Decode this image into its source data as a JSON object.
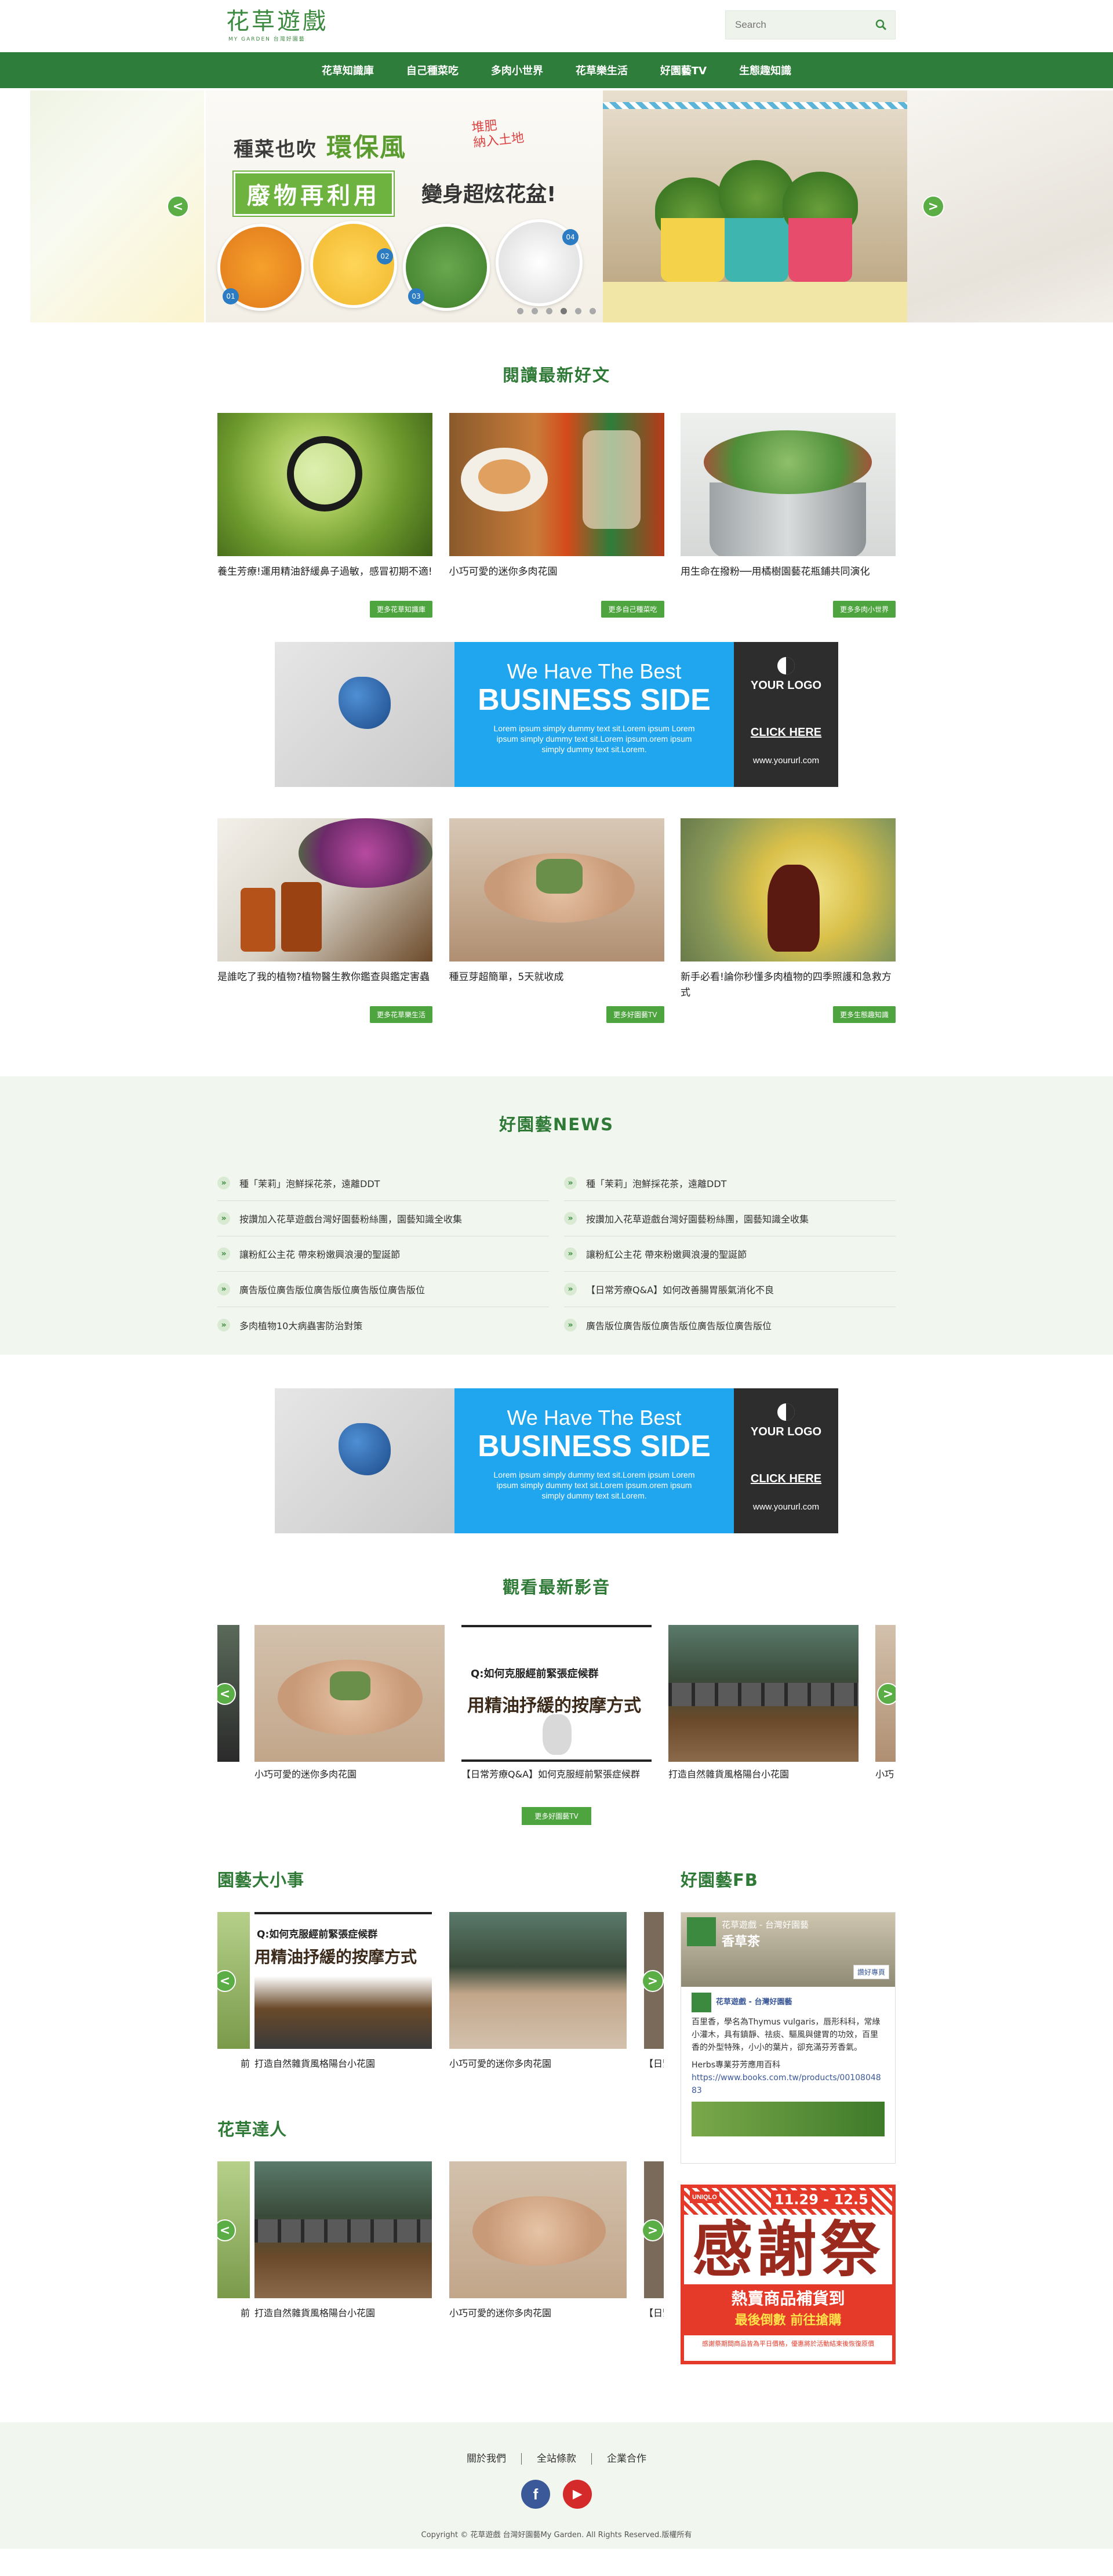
{
  "header": {
    "logo_main": "花草遊戲",
    "logo_sub": "MY GARDEN 台灣好園藝",
    "search_placeholder": "Search"
  },
  "nav": [
    "花草知識庫",
    "自己種菜吃",
    "多肉小世界",
    "花草樂生活",
    "好園藝TV",
    "生態趣知識"
  ],
  "hero": {
    "line1": "種菜也吹",
    "line1_big": "環保風",
    "tag": "堆肥\n納入土地",
    "box": "廢物再利用",
    "line2": "變身超炫花盆!",
    "pot_numbers": [
      "01",
      "02",
      "03",
      "04"
    ],
    "prev": "<",
    "next": ">"
  },
  "articles": {
    "title": "閱讀最新好文",
    "items": [
      {
        "title": "養生芳療!運用精油舒緩鼻子過敏，感冒初期不適!",
        "button": "更多花草知識庫"
      },
      {
        "title": "小巧可愛的迷你多肉花園",
        "button": "更多自己種菜吃"
      },
      {
        "title": "用生命在撥粉──用橘樹園藝花瓶鋪共同演化",
        "button": "更多多肉小世界"
      },
      {
        "title": "是誰吃了我的植物?植物醫生教你鑑查與鑑定害蟲",
        "button": "更多花草樂生活"
      },
      {
        "title": "種豆芽超簡單，5天就收成",
        "button": "更多好園藝TV"
      },
      {
        "title": "新手必看!論你秒懂多肉植物的四季照護和急救方式",
        "button": "更多生態趣知識"
      }
    ]
  },
  "ad": {
    "headline1": "We Have The Best",
    "headline2": "BUSINESS SIDE",
    "body": "Lorem ipsum simply dummy text sit.Lorem ipsum Lorem ipsum simply dummy text sit.Lorem ipsum.orem ipsum simply dummy text sit.Lorem.",
    "logo": "YOUR LOGO",
    "cta": "CLICK HERE",
    "url": "www.yoururl.com"
  },
  "news": {
    "title": "好園藝NEWS",
    "left": [
      "種「茉莉」泡鮮採花茶，遠離DDT",
      "按讚加入花草遊戲台灣好園藝粉絲團，園藝知識全收集",
      "讓粉紅公主花 帶來粉嫩興浪漫的聖誕節",
      "廣告版位廣告版位廣告版位廣告版位廣告版位",
      "多肉植物10大病蟲害防治對策"
    ],
    "right": [
      "種「茉莉」泡鮮採花茶，遠離DDT",
      "按讚加入花草遊戲台灣好園藝粉絲團，園藝知識全收集",
      "讓粉紅公主花 帶來粉嫩興浪漫的聖誕節",
      "【日常芳療Q&A】如何改善腸胃脹氣消化不良",
      "廣告版位廣告版位廣告版位廣告版位廣告版位"
    ]
  },
  "videos": {
    "title": "觀看最新影音",
    "items": [
      {
        "title": "小巧可愛的迷你多肉花園"
      },
      {
        "title": "【日常芳療Q&A】如何克服經前緊張症候群"
      },
      {
        "title": "打造自然雜貨風格陽台小花園"
      },
      {
        "title": "小巧"
      }
    ],
    "overlay_caption": "用精油抒緩的按摩方式",
    "overlay_top": "Q:如何克服經前緊張症候群",
    "more": "更多好園藝TV"
  },
  "garden_events": {
    "title": "園藝大小事",
    "items": [
      {
        "title": "前"
      },
      {
        "title": "打造自然雜貨風格陽台小花園"
      },
      {
        "title": "小巧可愛的迷你多肉花園"
      },
      {
        "title": "【日緊張"
      }
    ]
  },
  "experts": {
    "title": "花草達人",
    "items": [
      {
        "title": "前"
      },
      {
        "title": "打造自然雜貨風格陽台小花園"
      },
      {
        "title": "小巧可愛的迷你多肉花園"
      },
      {
        "title": "【日緊張"
      }
    ]
  },
  "fb": {
    "title": "好園藝FB",
    "page_name": "花草遊戲 - 台灣好園藝",
    "post_author": "花草遊戲 - 台灣好園藝",
    "post_text": "百里香，學名為Thymus vulgaris，唇形科科，常綠小灌木，具有鎮靜、祛痰、驅風與健胃的功效，百里香的外型特殊，小小的葉片，卻充滿芬芳香氣。",
    "post_link_text": "Herbs專業芬芳應用百科",
    "post_link": "https://www.books.com.tw/products/0010804883",
    "like_label": "讚好專頁",
    "thumb_text": "香草茶"
  },
  "promo": {
    "brand": "UNIQLO",
    "date": "11.29 - 12.5",
    "big": "感謝祭",
    "bar1": "熱賣商品補貨到",
    "bar2": "最後倒數 前往搶購",
    "foot": "感謝祭期間商品皆為平日價格，優惠將於活動結束後恢復原價"
  },
  "footer": {
    "links": [
      "關於我們",
      "全站條款",
      "企業合作"
    ],
    "facebook": "f",
    "youtube": "▶",
    "copyright": "Copyright © 花草遊戲 台灣好園藝My Garden. All Rights Reserved.版權所有"
  },
  "colors": {
    "brand_green": "#2e7d3b",
    "button_green": "#4ea53f",
    "news_bg": "#f1f6ef",
    "ad_blue": "#1fa6ee",
    "facebook": "#3b5998",
    "youtube": "#d42a2a"
  },
  "icons": {
    "search": "search-icon",
    "bullet": "double-chevron-right-icon",
    "arrows": [
      "chevron-left-icon",
      "chevron-right-icon"
    ],
    "social": [
      "facebook-icon",
      "youtube-icon"
    ]
  }
}
